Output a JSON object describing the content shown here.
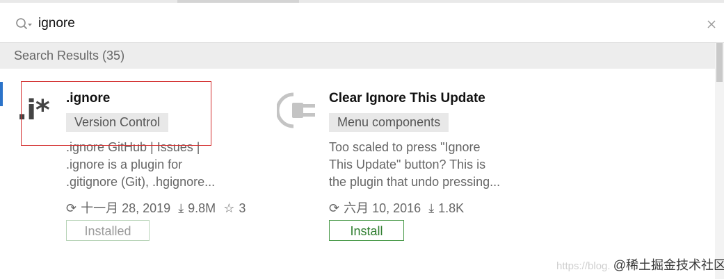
{
  "search": {
    "query": "ignore"
  },
  "results_header": "Search Results (35)",
  "plugins": [
    {
      "logo_text": ".i*",
      "name": ".ignore",
      "category": "Version Control",
      "description": [
        ".ignore GitHub | Issues |",
        ".ignore is a plugin for",
        ".gitignore (Git), .hgignore..."
      ],
      "date": "十一月 28, 2019",
      "downloads": "9.8M",
      "rating": "3",
      "button": "Installed"
    },
    {
      "logo_icon": "plug-icon",
      "name": "Clear Ignore This Update",
      "category": "Menu components",
      "description": [
        "Too scaled to press \"Ignore",
        "This Update\" button? This is",
        "the plugin that undo pressing..."
      ],
      "date": "六月 10, 2016",
      "downloads": "1.8K",
      "button": "Install"
    }
  ],
  "watermark": {
    "url_text": "https://blog.",
    "brand": "@稀土掘金技术社区"
  },
  "colors": {
    "accent_blue": "#2b73c9",
    "install_green": "#2e7d2e",
    "highlight_red": "#d22b2b"
  }
}
